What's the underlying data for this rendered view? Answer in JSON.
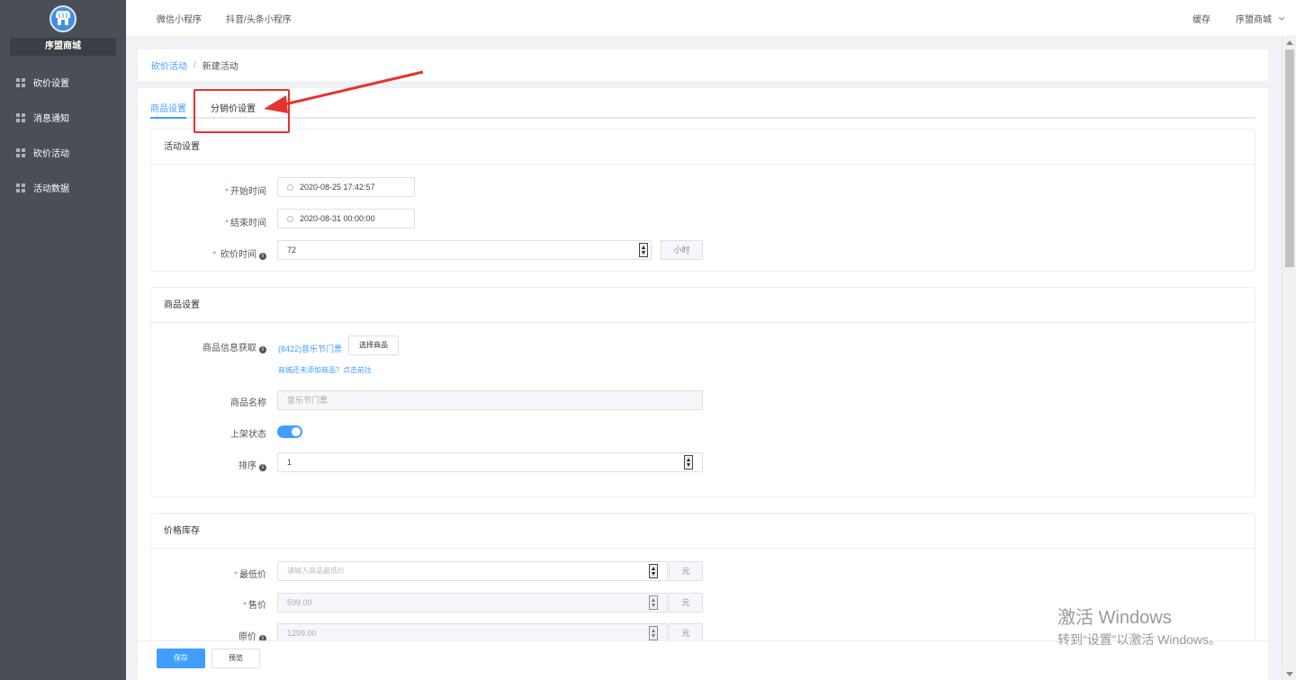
{
  "sidebar": {
    "shop_name": "序盟商城",
    "items": [
      {
        "label": "砍价设置"
      },
      {
        "label": "消息通知"
      },
      {
        "label": "砍价活动"
      },
      {
        "label": "活动数据"
      }
    ]
  },
  "header": {
    "tabs": [
      "微信小程序",
      "抖音/头条小程序"
    ],
    "cache": "缓存",
    "account": "序盟商城"
  },
  "breadcrumb": {
    "parent": "砍价活动",
    "separator": "/",
    "current": "新建活动"
  },
  "tabs": {
    "goods": "商品设置",
    "distribution": "分销价设置"
  },
  "activity_settings": {
    "title": "活动设置",
    "start_label": "开始时间",
    "start_value": "2020-08-25 17:42:57",
    "end_label": "结束时间",
    "end_value": "2020-08-31 00:00:00",
    "bargain_label": "砍价时间",
    "bargain_value": "72",
    "bargain_unit": "小时"
  },
  "goods_settings": {
    "title": "商品设置",
    "info_label": "商品信息获取",
    "info_value": "(8422)音乐节门票",
    "select_button": "选择商品",
    "hint": "商城还未添加商品？点击前往",
    "name_label": "商品名称",
    "name_value": "音乐节门票",
    "status_label": "上架状态",
    "status_on": true,
    "sort_label": "排序",
    "sort_value": "1"
  },
  "price_stock": {
    "title": "价格库存",
    "min_label": "最低价",
    "min_placeholder": "请输入商品最低价",
    "sale_label": "售价",
    "sale_value": "599.00",
    "orig_label": "原价",
    "orig_value": "1299.00",
    "unit": "元"
  },
  "footer": {
    "save": "保存",
    "preview": "预览"
  },
  "watermark": {
    "line1": "激活 Windows",
    "line2": "转到“设置”以激活 Windows。"
  },
  "colors": {
    "accent": "#409eff",
    "sidebar": "#4a4f57",
    "annotation": "#e8322d"
  }
}
